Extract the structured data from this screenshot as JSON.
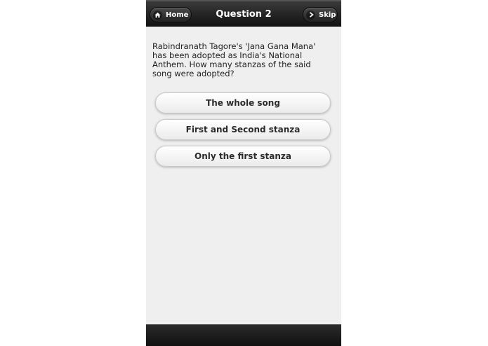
{
  "header": {
    "title": "Question 2",
    "home_label": "Home",
    "skip_label": "Skip",
    "home_icon": "home-icon",
    "skip_icon": "chevron-right-icon"
  },
  "question": {
    "text": "Rabindranath Tagore's 'Jana Gana Mana' has been adopted as India's National Anthem. How many stanzas of the said song were adopted?"
  },
  "answers": [
    {
      "label": "The whole song"
    },
    {
      "label": "First and Second stanza"
    },
    {
      "label": "Only the first stanza"
    }
  ],
  "colors": {
    "header_bg": "#1f1f1f",
    "page_bg": "#efefef",
    "button_text": "#2b2b2b"
  }
}
